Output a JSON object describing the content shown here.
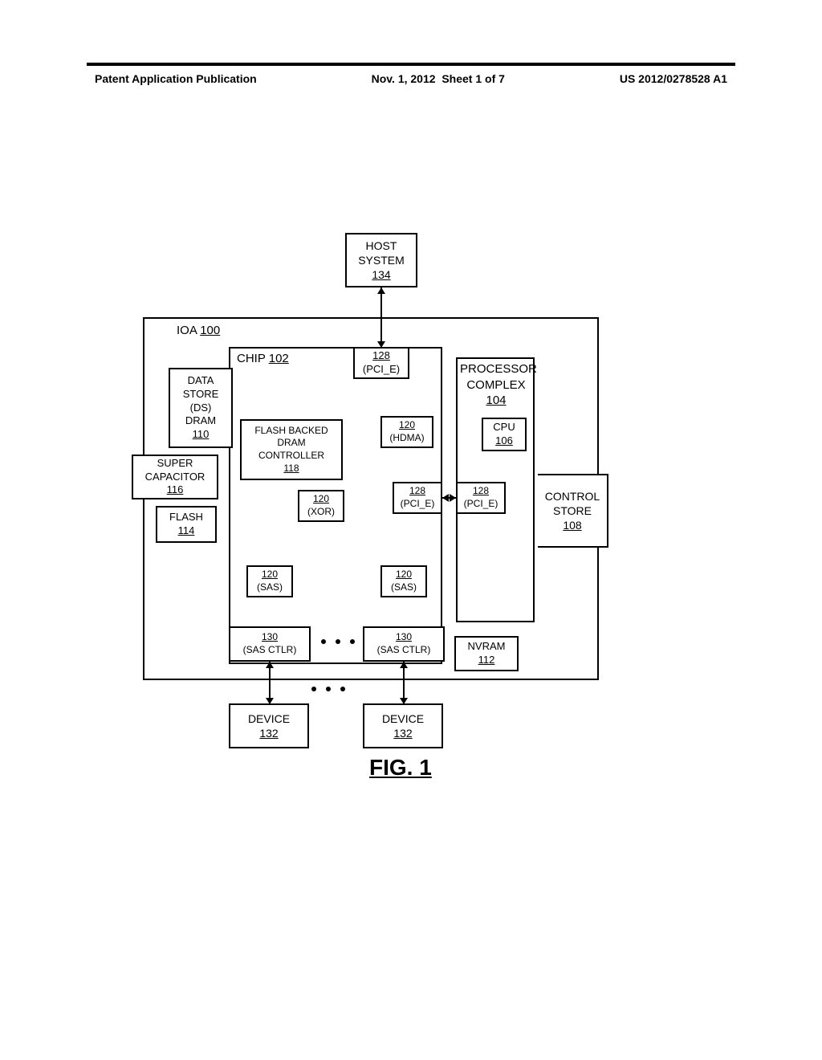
{
  "header": {
    "pub_type": "Patent Application Publication",
    "date": "Nov. 1, 2012",
    "sheet": "Sheet 1 of 7",
    "pub_no": "US 2012/0278528 A1"
  },
  "labels": {
    "ioa": "IOA",
    "ioa_ref": "100",
    "chip": "CHIP",
    "chip_ref": "102"
  },
  "blocks": {
    "host": {
      "line1": "HOST",
      "line2": "SYSTEM",
      "ref": "134"
    },
    "pcie_top": {
      "ref": "128",
      "sub": "(PCI_E)"
    },
    "processor": {
      "line1": "PROCESSOR",
      "line2": "COMPLEX",
      "ref": "104"
    },
    "cpu": {
      "line1": "CPU",
      "ref": "106"
    },
    "pcie_r": {
      "ref": "128",
      "sub": "(PCI_E)"
    },
    "pcie_l": {
      "ref": "128",
      "sub": "(PCI_E)"
    },
    "ctrlstore": {
      "line1": "CONTROL",
      "line2": "STORE",
      "ref": "108"
    },
    "ds_dram": {
      "line1": "DATA",
      "line2": "STORE",
      "line3": "(DS)",
      "line4": "DRAM",
      "ref": "110"
    },
    "supercap": {
      "line1": "SUPER",
      "line2": "CAPACITOR",
      "ref": "116"
    },
    "flash": {
      "line1": "FLASH",
      "ref": "114"
    },
    "fbdc": {
      "line1": "FLASH BACKED",
      "line2": "DRAM",
      "line3": "CONTROLLER",
      "ref": "118"
    },
    "hdma": {
      "ref": "120",
      "sub": "(HDMA)"
    },
    "xor": {
      "ref": "120",
      "sub": "(XOR)"
    },
    "sas_l": {
      "ref": "120",
      "sub": "(SAS)"
    },
    "sas_r": {
      "ref": "120",
      "sub": "(SAS)"
    },
    "sasctlr_l": {
      "ref": "130",
      "sub": "(SAS CTLR)"
    },
    "sasctlr_r": {
      "ref": "130",
      "sub": "(SAS CTLR)"
    },
    "nvram": {
      "line1": "NVRAM",
      "ref": "112"
    },
    "device_l": {
      "line1": "DEVICE",
      "ref": "132"
    },
    "device_r": {
      "line1": "DEVICE",
      "ref": "132"
    }
  },
  "figure": {
    "caption": "FIG. 1"
  }
}
